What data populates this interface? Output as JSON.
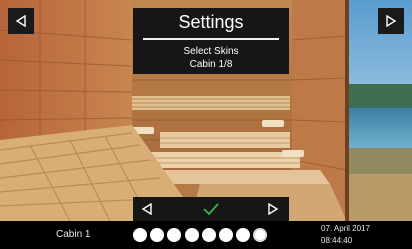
{
  "nav": {
    "prev_icon": "triangle-left-icon",
    "next_icon": "triangle-right-icon"
  },
  "settings": {
    "title": "Settings",
    "subtitle": "Select Skins",
    "skin_label": "Cabin 1/8"
  },
  "skin_controls": {
    "prev_icon": "triangle-left-icon",
    "confirm_icon": "checkmark-icon",
    "confirm_color": "#39b54a",
    "next_icon": "triangle-right-icon"
  },
  "status": {
    "cabin": "Cabin 1",
    "skins_total": 8,
    "skins_active": 8,
    "date": "07. April 2017",
    "time": "08:44:40"
  }
}
